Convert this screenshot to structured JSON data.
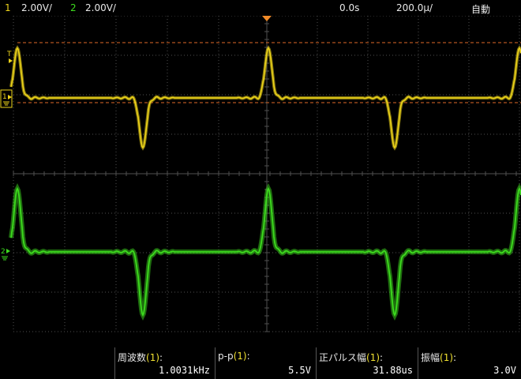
{
  "colors": {
    "ch1": "#ecd31a",
    "ch2": "#3ddc1e",
    "trigger": "#f08a28",
    "grid": "#505050",
    "background": "#000000"
  },
  "topbar": {
    "ch1_num": "1",
    "ch1_scale": "2.00V/",
    "ch2_num": "2",
    "ch2_scale": "2.00V/",
    "delay": "0.0s",
    "timebase": "200.0µ/",
    "trigger_mode": "自動"
  },
  "markers": {
    "trigger_marker": "T",
    "ch1_marker": "1",
    "ch2_marker": "2"
  },
  "measurements": [
    {
      "label": "周波数",
      "source": "(1)",
      "suffix": ":",
      "value": "1.0031kHz"
    },
    {
      "label": "p-p",
      "source": "(1)",
      "suffix": ":",
      "value": "5.5V"
    },
    {
      "label": "正パルス幅",
      "source": "(1)",
      "suffix": ":",
      "value": "31.88us"
    },
    {
      "label": "振幅",
      "source": "(1)",
      "suffix": ":",
      "value": "3.0V"
    }
  ]
}
